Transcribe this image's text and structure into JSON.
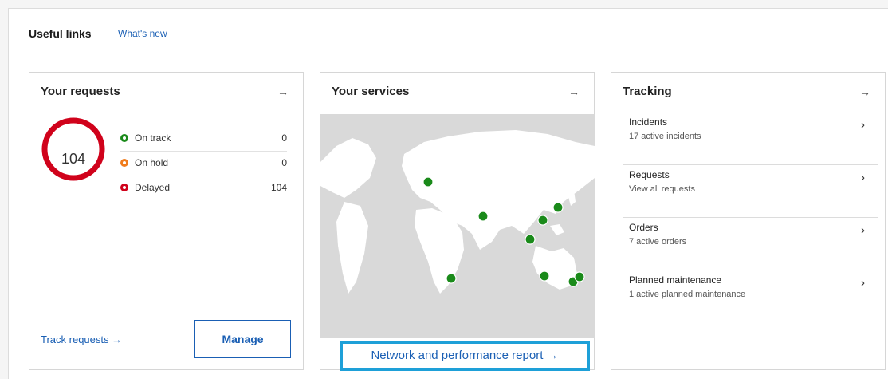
{
  "useful_links": {
    "title": "Useful links",
    "whats_new": "What's new"
  },
  "requests": {
    "title": "Your requests",
    "arrow_icon": "arrow-right-icon",
    "total": "104",
    "statuses": [
      {
        "label": "On track",
        "count": "0",
        "color": "#1a8a1a",
        "icon": "play-icon"
      },
      {
        "label": "On hold",
        "count": "0",
        "color": "#f07c1c",
        "icon": "pause-icon"
      },
      {
        "label": "Delayed",
        "count": "104",
        "color": "#d0021b",
        "icon": "stop-icon"
      }
    ],
    "track_link": "Track requests",
    "manage_label": "Manage"
  },
  "services": {
    "title": "Your services",
    "report_link": "Network and performance report →",
    "map_marker_color": "#1a8a1a",
    "map_land_color": "#ffffff",
    "map_sea_color": "#d9d9d9"
  },
  "tracking": {
    "title": "Tracking",
    "items": [
      {
        "title": "Incidents",
        "subtitle": "17 active incidents"
      },
      {
        "title": "Requests",
        "subtitle": "View all requests"
      },
      {
        "title": "Orders",
        "subtitle": "7 active orders"
      },
      {
        "title": "Planned maintenance",
        "subtitle": "1 active planned maintenance"
      }
    ]
  },
  "accent_color": "#1a5fb4",
  "highlight_color": "#1ea0d8",
  "ring_color": "#d0021b"
}
